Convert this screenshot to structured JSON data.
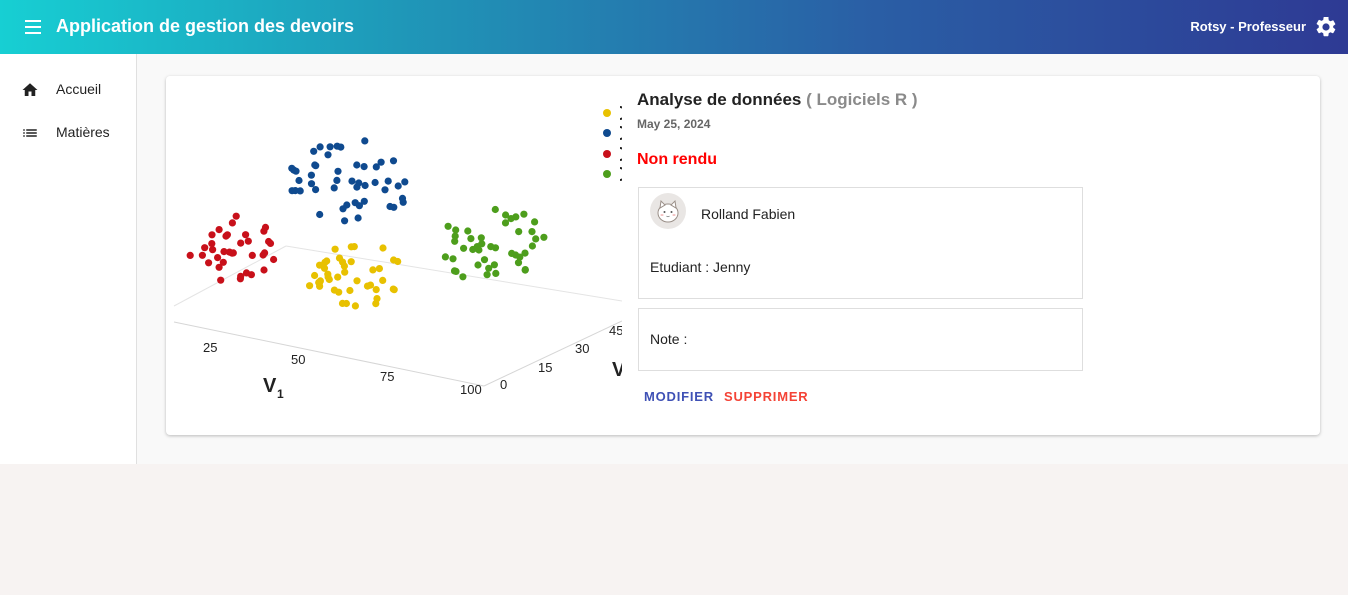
{
  "header": {
    "app_title": "Application de gestion des devoirs",
    "user_label": "Rotsy - Professeur",
    "menu_icon": "menu-icon",
    "settings_icon": "gear-icon"
  },
  "sidebar": {
    "items": [
      {
        "label": "Accueil",
        "icon": "home-icon"
      },
      {
        "label": "Matières",
        "icon": "list-icon"
      }
    ]
  },
  "assignment": {
    "title": "Analyse de données",
    "subject": "( Logiciels R )",
    "date": "May 25, 2024",
    "status": "Non rendu",
    "status_color": "#ff0000",
    "teacher": "Rolland Fabien",
    "student": "Etudiant : Jenny",
    "note": "Note :",
    "edit_label": "MODIFIER",
    "delete_label": "SUPPRIMER",
    "image": {
      "axis_v1_ticks": [
        "25",
        "50",
        "75",
        "100"
      ],
      "axis_v2_ticks": [
        "0",
        "15",
        "30",
        "45"
      ],
      "axis_v1_label": "V",
      "axis_v1_sub": "1",
      "axis_v2_label": "V",
      "cluster_colors": [
        "#e8c100",
        "#0f4a8f",
        "#c8101a",
        "#4d9e1c"
      ]
    }
  },
  "colors": {
    "edit": "#3f51b5",
    "delete": "#f44336"
  }
}
